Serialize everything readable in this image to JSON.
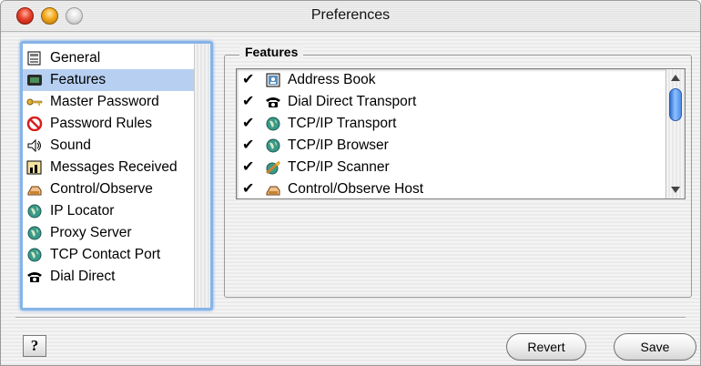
{
  "window": {
    "title": "Preferences"
  },
  "sidebar": {
    "items": [
      {
        "label": "General",
        "icon": "general-icon",
        "selected": false
      },
      {
        "label": "Features",
        "icon": "features-icon",
        "selected": true
      },
      {
        "label": "Master Password",
        "icon": "key-icon",
        "selected": false
      },
      {
        "label": "Password Rules",
        "icon": "no-entry-icon",
        "selected": false
      },
      {
        "label": "Sound",
        "icon": "speaker-icon",
        "selected": false
      },
      {
        "label": "Messages Received",
        "icon": "messages-icon",
        "selected": false
      },
      {
        "label": "Control/Observe",
        "icon": "hand-icon",
        "selected": false
      },
      {
        "label": "IP Locator",
        "icon": "globe-icon",
        "selected": false
      },
      {
        "label": "Proxy Server",
        "icon": "globe-icon",
        "selected": false
      },
      {
        "label": "TCP Contact Port",
        "icon": "globe-icon",
        "selected": false
      },
      {
        "label": "Dial Direct",
        "icon": "phone-icon",
        "selected": false
      }
    ]
  },
  "features": {
    "group_label": "Features",
    "rows": [
      {
        "label": "Address Book",
        "icon": "address-book-icon",
        "checked": "✔"
      },
      {
        "label": "Dial Direct Transport",
        "icon": "phone-icon",
        "checked": "✔"
      },
      {
        "label": "TCP/IP Transport",
        "icon": "globe-icon",
        "checked": "✔"
      },
      {
        "label": "TCP/IP Browser",
        "icon": "globe-icon",
        "checked": "✔"
      },
      {
        "label": "TCP/IP Scanner",
        "icon": "scanner-icon",
        "checked": "✔"
      },
      {
        "label": "Control/Observe Host",
        "icon": "hand-icon",
        "checked": "✔"
      }
    ]
  },
  "footer": {
    "help_label": "?",
    "revert_label": "Revert",
    "save_label": "Save"
  }
}
